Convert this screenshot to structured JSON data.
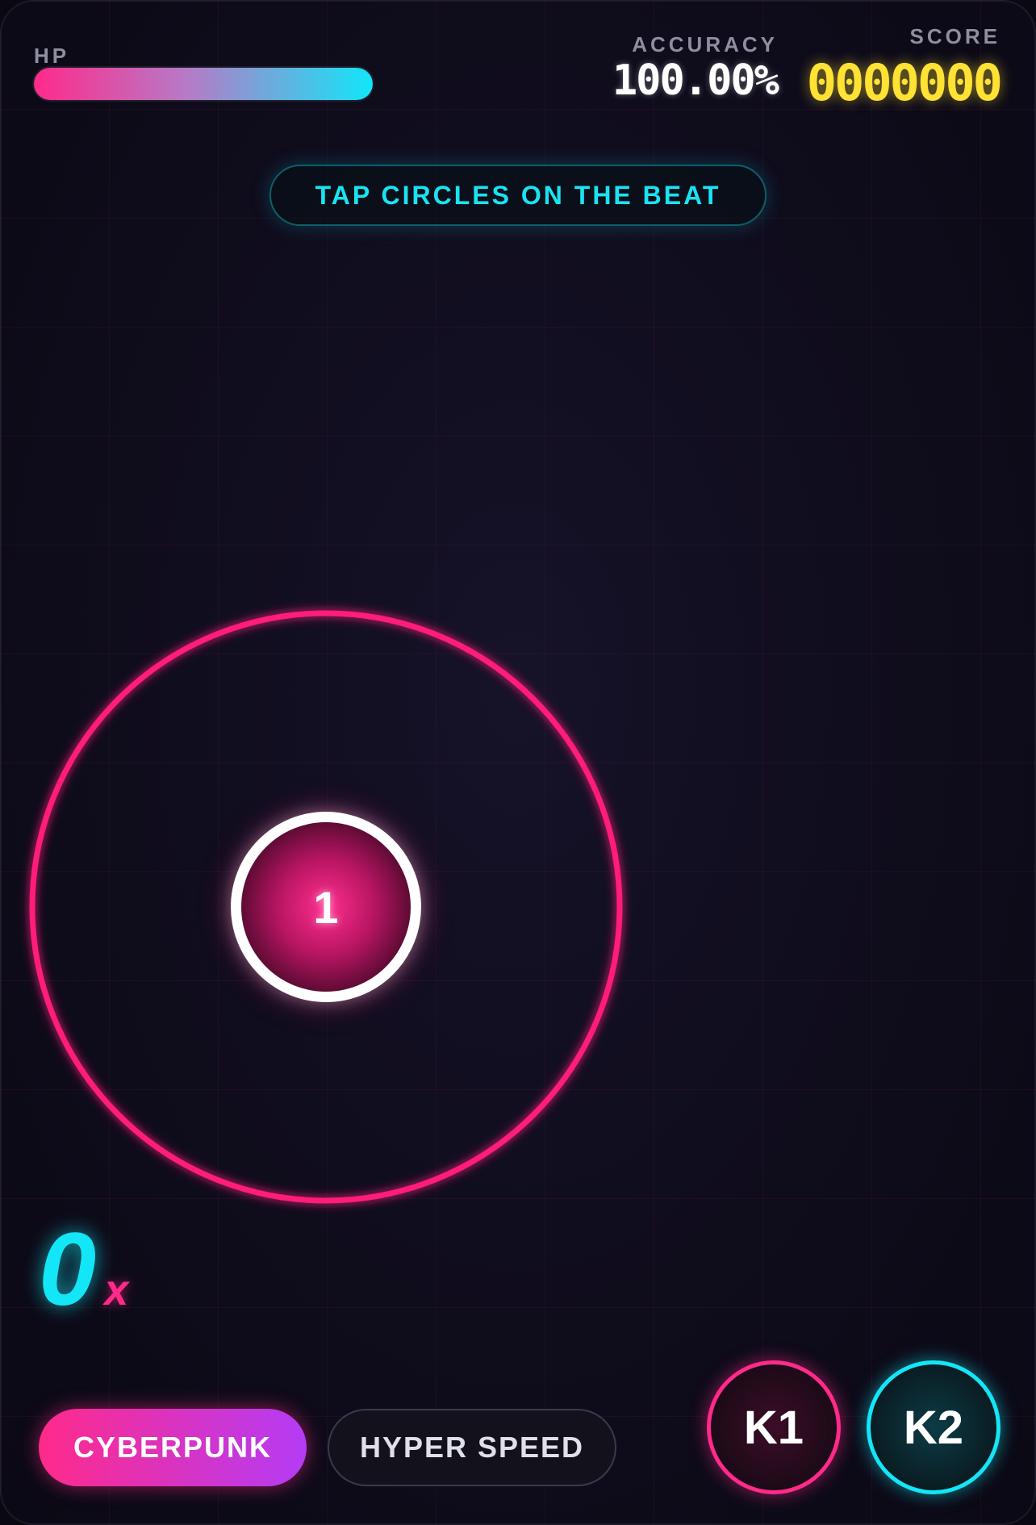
{
  "hud": {
    "hp_label": "HP",
    "hp_level": 1.0,
    "accuracy_label": "ACCURACY",
    "accuracy_value": "100.00%",
    "score_label": "SCORE",
    "score_value": "0000000"
  },
  "hint": "TAP CIRCLES ON THE BEAT",
  "hit_object": {
    "number": "1",
    "approach_color": "#ff1f7a",
    "circle_color": "#ff2f8e"
  },
  "combo": {
    "count": "0",
    "suffix": "x"
  },
  "modes": {
    "cyberpunk_label": "CYBERPUNK",
    "hyper_speed_label": "HYPER SPEED"
  },
  "keys": {
    "k1_label": "K1",
    "k2_label": "K2"
  },
  "colors": {
    "pink": "#ff2a8a",
    "cyan": "#13e6f6",
    "yellow": "#ffe233"
  }
}
